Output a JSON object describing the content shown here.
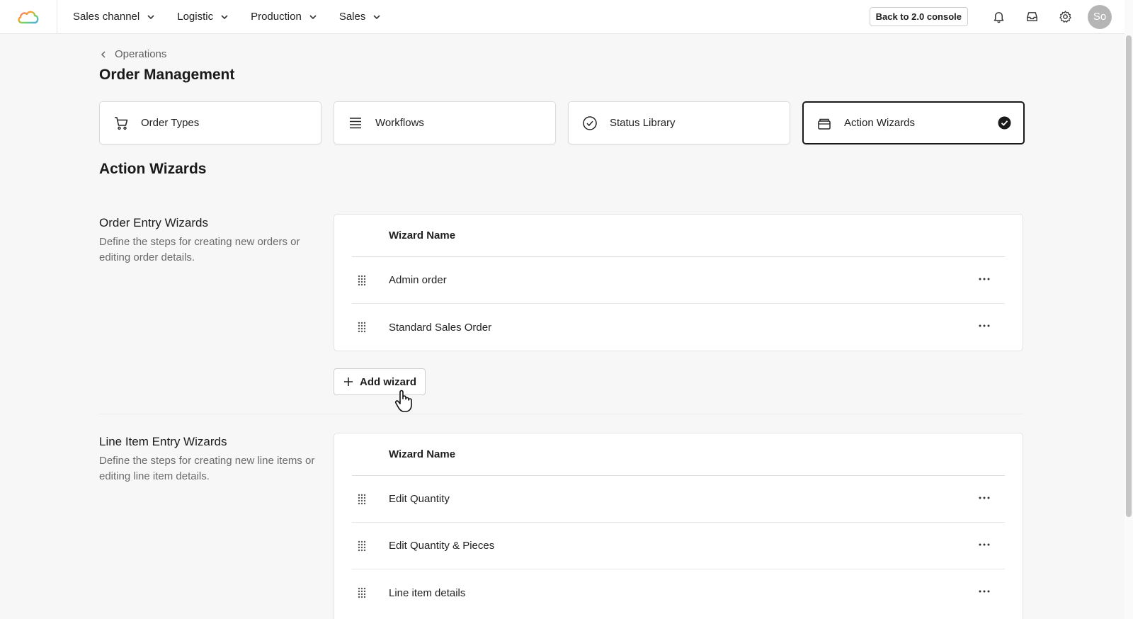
{
  "nav": {
    "menu": [
      {
        "label": "Sales channel"
      },
      {
        "label": "Logistic"
      },
      {
        "label": "Production"
      },
      {
        "label": "Sales"
      }
    ],
    "console_button": "Back to 2.0 console",
    "avatar_initials": "So"
  },
  "breadcrumb": {
    "label": "Operations"
  },
  "page_title": "Order Management",
  "tabs": [
    {
      "label": "Order Types",
      "icon": "cart-icon"
    },
    {
      "label": "Workflows",
      "icon": "list-icon"
    },
    {
      "label": "Status Library",
      "icon": "check-circle-icon"
    },
    {
      "label": "Action Wizards",
      "icon": "stack-icon",
      "active": true
    }
  ],
  "section_title": "Action Wizards",
  "order_entry": {
    "title": "Order Entry Wizards",
    "description": "Define the steps for creating new orders or editing order details.",
    "column_header": "Wizard Name",
    "rows": [
      "Admin order",
      "Standard Sales Order"
    ],
    "add_button": "Add wizard"
  },
  "line_item_entry": {
    "title": "Line Item Entry Wizards",
    "description": "Define the steps for creating new line items or editing line item details.",
    "column_header": "Wizard Name",
    "rows": [
      "Edit Quantity",
      "Edit Quantity & Pieces",
      "Line item details"
    ]
  },
  "colors": {
    "accent": "#1a1a1a",
    "background": "#f7f7f7"
  }
}
